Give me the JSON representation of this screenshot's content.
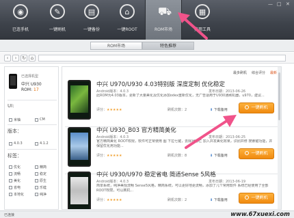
{
  "toolbar": {
    "items": [
      {
        "label": "已连手机",
        "icon": "android-icon",
        "glyph": "◉"
      },
      {
        "label": "一键刷机",
        "icon": "flash-icon",
        "glyph": "✎"
      },
      {
        "label": "一键备份",
        "icon": "backup-icon",
        "glyph": "▤"
      },
      {
        "label": "一键ROOT",
        "icon": "lock-icon",
        "glyph": "⌂"
      },
      {
        "label": "ROM市场",
        "icon": "cart-icon",
        "glyph": "⛟"
      },
      {
        "label": "实用工具",
        "icon": "toolbox-icon",
        "glyph": "▦"
      }
    ],
    "window_controls": [
      "—",
      "□",
      "✕"
    ]
  },
  "tabs": [
    "ROM市场",
    "特色推荐"
  ],
  "nav": {
    "back": "‹",
    "forward": "›",
    "refresh": "↻",
    "home": "⌂"
  },
  "device": {
    "title": "已选择机型",
    "model": "中兴 U930",
    "rom_label": "ROM:",
    "rom_count": "17"
  },
  "filters": {
    "ui_title": "UI:",
    "ui_options": [
      "米柚",
      "CM"
    ],
    "version_title": "版本：",
    "version_options": [
      "4.0.3",
      "4.1.2"
    ],
    "tag_title": "标签：",
    "tag_options": [
      "优化",
      "精简",
      "流畅",
      "稳定",
      "美化",
      "原生",
      "省电",
      "乐蛙",
      "本地化",
      "纯净"
    ]
  },
  "sort": {
    "items": [
      "最多刷机",
      "综合评分",
      "最新"
    ]
  },
  "roms": [
    {
      "title": "中兴 U970/U930 4.03特别版 深度定制 优化稳定",
      "version": "Android版本：4.0.3",
      "date": "发布日期：2013-06-26",
      "desc": "此ROM为4.03版本，更新了大量美化及优化添加odex重新优化，无广告适用于U930通刷机器，u970，建议...",
      "rating": "评分：",
      "stars": "★★★★★",
      "downloads": "刷机次数：2",
      "download_link": "下载备用",
      "button": "一键刷机"
    },
    {
      "title": "中兴 U930_B03 官方精简美化",
      "version": "Android版本：4.0.3",
      "date": "发布日期：2013-06-25",
      "desc": "官方精简美化 ROOT权限，软件可正常使用 图 下拉七键，去除状态栏 加入并发美化效果，识别并修 搜索键功能，并保留优化用功能...",
      "rating": "评分：",
      "stars": "★★★★★",
      "downloads": "刷机次数：8",
      "download_link": "下载备用",
      "button": "一键刷机"
    },
    {
      "title": "中兴 U930/U970 稳定省电 简适Sense 5风格",
      "version": "Android版本：4.0.3",
      "date": "发布日期：2013-06-19",
      "desc": "简单系统，纯净美观流畅 Sense5风格，精简系统，可以更好地更流畅，添加了几个常用软件 系统已经使用了全部ROOT权限，可以刷机...",
      "rating": "评分：",
      "stars": "★★★★★",
      "downloads": "刷机次数：2",
      "download_link": "下载备用",
      "button": "一键刷机"
    }
  ],
  "status": {
    "text": "已连接"
  },
  "watermark": "www.67xuexi.com",
  "colors": {
    "accent": "#f08a10",
    "arrow": "#f0538a"
  }
}
